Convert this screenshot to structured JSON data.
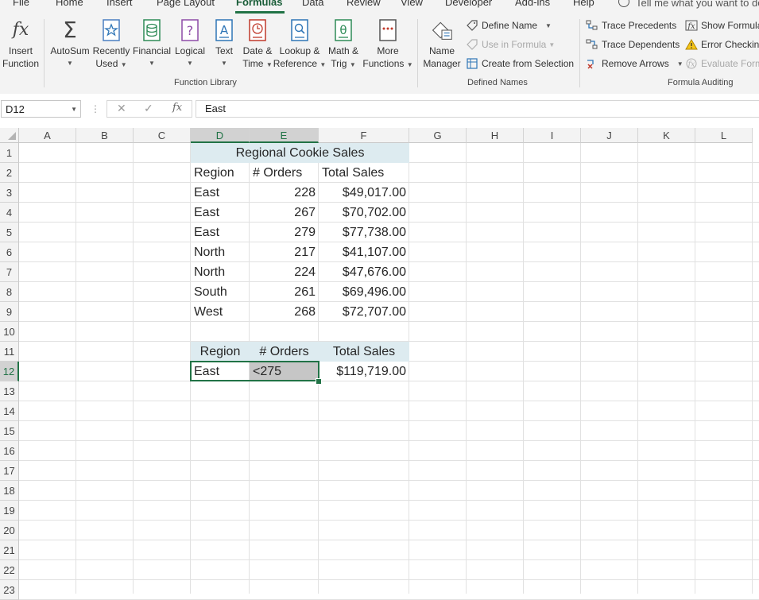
{
  "tabs": [
    "File",
    "Home",
    "Insert",
    "Page Layout",
    "Formulas",
    "Data",
    "Review",
    "View",
    "Developer",
    "Add-ins",
    "Help"
  ],
  "tell_me": "Tell me what you want to do",
  "ribbon": {
    "insert_function": {
      "line1": "Insert",
      "line2": "Function"
    },
    "autosum": {
      "line1": "AutoSum"
    },
    "recently_used": {
      "line1": "Recently",
      "line2": "Used"
    },
    "financial": {
      "line1": "Financial"
    },
    "logical": {
      "line1": "Logical"
    },
    "text": {
      "line1": "Text"
    },
    "date_time": {
      "line1": "Date &",
      "line2": "Time"
    },
    "lookup_reference": {
      "line1": "Lookup &",
      "line2": "Reference"
    },
    "math_trig": {
      "line1": "Math &",
      "line2": "Trig"
    },
    "more_functions": {
      "line1": "More",
      "line2": "Functions"
    },
    "function_library_label": "Function Library",
    "name_manager": {
      "line1": "Name",
      "line2": "Manager"
    },
    "define_name": "Define Name",
    "use_in_formula": "Use in Formula",
    "create_from_selection": "Create from Selection",
    "defined_names_label": "Defined Names",
    "trace_precedents": "Trace Precedents",
    "trace_dependents": "Trace Dependents",
    "remove_arrows": "Remove Arrows",
    "show_formulas": "Show Formulas",
    "error_checking": "Error Checking",
    "evaluate_formula": "Evaluate Formula",
    "formula_auditing_label": "Formula Auditing"
  },
  "formula_bar": {
    "name_box": "D12",
    "fx": "fx",
    "content": "East"
  },
  "columns": [
    "A",
    "B",
    "C",
    "D",
    "E",
    "F",
    "G",
    "H",
    "I",
    "J",
    "K",
    "L"
  ],
  "rows": [
    "1",
    "2",
    "3",
    "4",
    "5",
    "6",
    "7",
    "8",
    "9",
    "10",
    "11",
    "12",
    "13",
    "14",
    "15",
    "16",
    "17",
    "18",
    "19",
    "20",
    "21",
    "22",
    "23"
  ],
  "sheet": {
    "title": "Regional Cookie Sales",
    "headers": [
      "Region",
      "# Orders",
      "Total Sales"
    ],
    "data": [
      [
        "East",
        "228",
        "$49,017.00"
      ],
      [
        "East",
        "267",
        "$70,702.00"
      ],
      [
        "East",
        "279",
        "$77,738.00"
      ],
      [
        "North",
        "217",
        "$41,107.00"
      ],
      [
        "North",
        "224",
        "$47,676.00"
      ],
      [
        "South",
        "261",
        "$69,496.00"
      ],
      [
        "West",
        "268",
        "$72,707.00"
      ]
    ],
    "criteria_headers": [
      "Region",
      "# Orders",
      "Total Sales"
    ],
    "criteria": [
      "East",
      "<275",
      "$119,719.00"
    ]
  },
  "colors": {
    "accent": "#217346",
    "header_fill": "#ddebf0",
    "selected_fill": "#c6c6c6"
  }
}
